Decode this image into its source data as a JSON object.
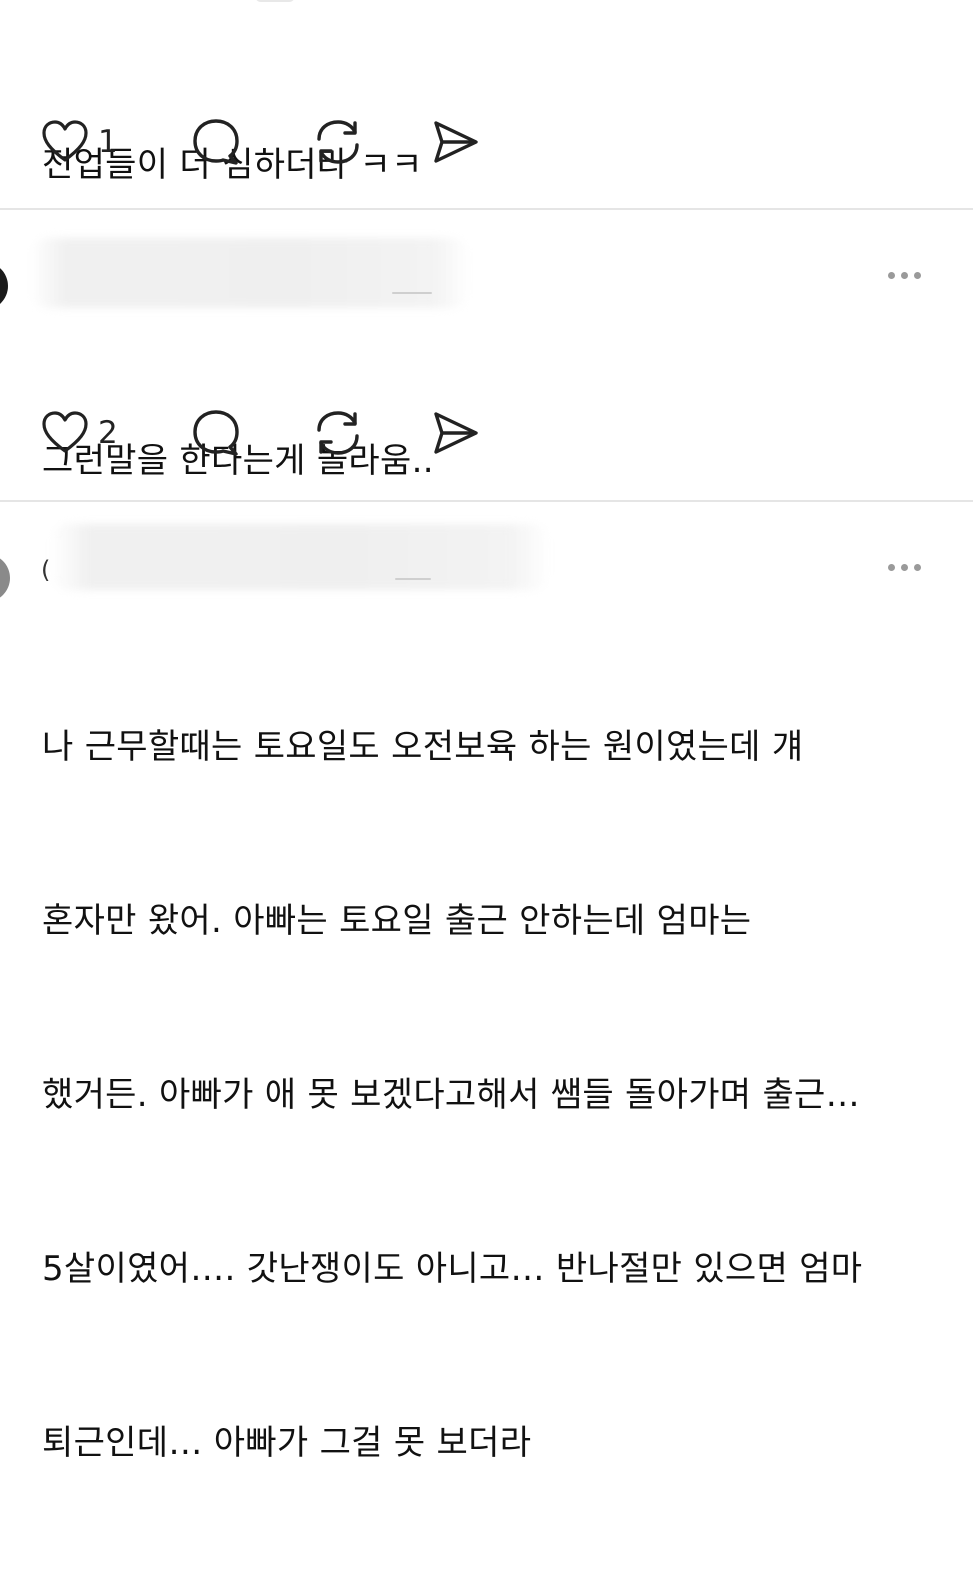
{
  "posts": [
    {
      "text_lines": [
        "전업들이 더 심하더라 ㅋㅋ"
      ],
      "likes": "1"
    },
    {
      "text_lines": [
        "그런말을 한다는게 놀라움.."
      ],
      "likes": "2"
    },
    {
      "username_visible": "(",
      "text_lines": [
        "나 근무할때는 토요일도 오전보육 하는 원이였는데 걔",
        "혼자만 왔어. 아빠는 토요일 출근 안하는데 엄마는",
        "했거든. 아빠가 애 못 보겠다고해서 쌤들 돌아가며 출근…",
        "5살이였어…. 갓난쟁이도 아니고… 반나절만 있으면 엄마",
        "퇴근인데… 아빠가 그걸 못 보더라"
      ]
    }
  ],
  "icons": {
    "like": "heart-icon",
    "reply": "comment-bubble-icon",
    "repost": "repost-icon",
    "share": "send-icon",
    "more": "more-dots-icon"
  },
  "colors": {
    "text": "#111111",
    "icon": "#222222",
    "divider": "#e5e5e5",
    "muted_dots": "#9a9a9a"
  }
}
